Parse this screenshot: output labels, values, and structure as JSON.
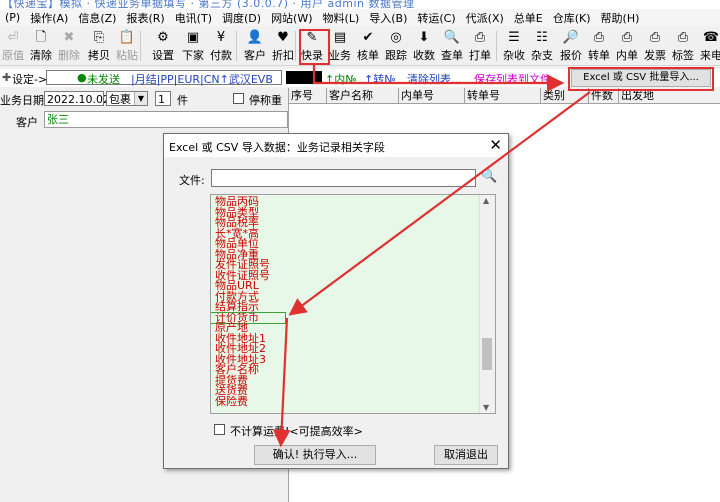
{
  "window": {
    "title_partial": "【快递宝】模拟 · 快递业务单据填写 · 第三方 (3.0.0.7) · 用户 admin 数据管理"
  },
  "menu": [
    "(P)",
    "操作(A)",
    "信息(Z)",
    "报表(R)",
    "电讯(T)",
    "调度(D)",
    "网站(W)",
    "物料(L)",
    "导入(B)",
    "转运(C)",
    "代派(X)",
    "总单E",
    "仓库(K)",
    "帮助(H)"
  ],
  "toolbar": {
    "buttons": [
      {
        "label": "原值",
        "icon": "restore-icon",
        "glyph": "⏎",
        "enabled": false
      },
      {
        "label": "清除",
        "icon": "clear-icon",
        "glyph": "🗋",
        "enabled": true
      },
      {
        "label": "删除",
        "icon": "delete-icon",
        "glyph": "✖",
        "enabled": false
      },
      {
        "label": "拷贝",
        "icon": "copy-icon",
        "glyph": "⎘",
        "enabled": true
      },
      {
        "label": "粘贴",
        "icon": "paste-icon",
        "glyph": "📋",
        "enabled": false
      },
      {
        "label": "设置",
        "icon": "settings-icon",
        "glyph": "⚙",
        "enabled": true
      },
      {
        "label": "下家",
        "icon": "downstream-icon",
        "glyph": "▣",
        "enabled": true
      },
      {
        "label": "付款",
        "icon": "payment-icon",
        "glyph": "¥",
        "enabled": true
      },
      {
        "label": "客户",
        "icon": "customer-icon",
        "glyph": "👤",
        "enabled": true
      },
      {
        "label": "折扣",
        "icon": "discount-icon",
        "glyph": "♥",
        "enabled": true
      },
      {
        "label": "快录",
        "icon": "quick-entry-icon",
        "glyph": "✎",
        "enabled": true
      },
      {
        "label": "业务",
        "icon": "business-icon",
        "glyph": "▤",
        "enabled": true
      },
      {
        "label": "核单",
        "icon": "verify-icon",
        "glyph": "✔",
        "enabled": true
      },
      {
        "label": "跟踪",
        "icon": "track-icon",
        "glyph": "◎",
        "enabled": true
      },
      {
        "label": "收数",
        "icon": "collect-icon",
        "glyph": "⬇",
        "enabled": true
      },
      {
        "label": "查单",
        "icon": "query-icon",
        "glyph": "🔍",
        "enabled": true
      },
      {
        "label": "打单",
        "icon": "print-icon",
        "glyph": "⎙",
        "enabled": true
      },
      {
        "label": "杂收",
        "icon": "misc-income-icon",
        "glyph": "☰",
        "enabled": true
      },
      {
        "label": "杂支",
        "icon": "misc-expense-icon",
        "glyph": "☷",
        "enabled": true
      },
      {
        "label": "报价",
        "icon": "quote-icon",
        "glyph": "🔎",
        "enabled": true
      },
      {
        "label": "转单",
        "icon": "transfer-icon",
        "glyph": "⎙",
        "enabled": true
      },
      {
        "label": "内单",
        "icon": "internal-order-icon",
        "glyph": "⎙",
        "enabled": true
      },
      {
        "label": "发票",
        "icon": "invoice-icon",
        "glyph": "⎙",
        "enabled": true
      },
      {
        "label": "标签",
        "icon": "label-icon",
        "glyph": "⎙",
        "enabled": true
      },
      {
        "label": "来电",
        "icon": "incoming-call-icon",
        "glyph": "☎",
        "enabled": true
      }
    ]
  },
  "row2": {
    "setting_label": "设定->",
    "unsent": "未发送",
    "tags": "|月结|PP|EUR|CN↑武汉EVB",
    "inner_no": "↑内№",
    "transfer_no": "↑转№",
    "clear_list": "清除列表...",
    "save_list": "保存列表到文件...",
    "import_button": "Excel 或 CSV 批量导入..."
  },
  "form": {
    "date_label": "业务日期",
    "date_value": "2022.10.02",
    "package_type": "包裹",
    "count_value": "1",
    "count_unit": "件",
    "pause_weigh": "停称重",
    "customer_label": "客户",
    "customer_value": "张三"
  },
  "table": {
    "columns": [
      "序号",
      "客户名称",
      "内单号",
      "转单号",
      "类别",
      "件数",
      "出发地"
    ]
  },
  "dialog": {
    "title": "Excel 或 CSV 导入数据：业务记录相关字段",
    "file_label": "文件:",
    "file_value": "",
    "fields": [
      "物品丙码",
      "物品类型",
      "物品税率",
      "长*宽*高",
      "物品单位",
      "物品净重",
      "发件证照号",
      "收件证照号",
      "物品URL",
      "付款方式",
      "结算指示",
      "计价货币",
      "原产地",
      "收件地址1",
      "收件地址2",
      "收件地址3",
      "客户名称",
      "提货费",
      "送货费",
      "保险费"
    ],
    "selected_field": "计价货币",
    "no_freight_checkbox": "不计算运费!<可提高效率>",
    "confirm_button": "确认! 执行导入...",
    "cancel_button": "取消退出"
  },
  "colors": {
    "accent_red": "#e03030",
    "list_bg": "#e8f8e8",
    "field_text": "#cc0000",
    "link_blue": "#1f3fbf",
    "link_magenta": "#cc00cc",
    "green_dot": "#008800"
  }
}
